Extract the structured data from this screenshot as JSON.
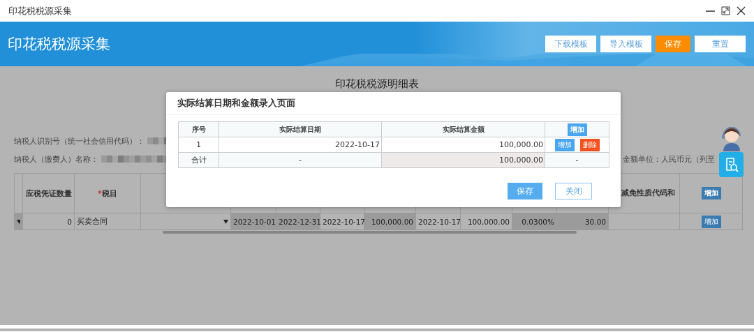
{
  "window": {
    "title": "印花税税源采集"
  },
  "header": {
    "title": "印花税税源采集",
    "buttons": [
      {
        "label": "下载模板",
        "kind": "default"
      },
      {
        "label": "导入模板",
        "kind": "default"
      },
      {
        "label": "保存",
        "kind": "primary"
      },
      {
        "label": "重置",
        "kind": "default"
      }
    ]
  },
  "page": {
    "table_title": "印花税税源明细表",
    "taxpayer_id_label": "纳税人识别号（统一社会信用代码）：",
    "taxpayer_name_label": "纳税人（缴费人）名称：",
    "currency_note": "金额单位：人民币元（列至",
    "table": {
      "columns": [
        {
          "kind": "blank"
        },
        {
          "kind": "text",
          "label": "应税凭证数量"
        },
        {
          "kind": "text",
          "label": "税目",
          "required_mark": "*"
        },
        {
          "kind": "blank"
        },
        {
          "kind": "blank"
        },
        {
          "kind": "blank"
        },
        {
          "kind": "blank"
        },
        {
          "kind": "blank"
        },
        {
          "kind": "blank"
        },
        {
          "kind": "blank"
        },
        {
          "kind": "blank"
        },
        {
          "kind": "blank"
        },
        {
          "kind": "text",
          "label": "减免性质代码和"
        },
        {
          "kind": "button",
          "label": "增加"
        }
      ],
      "rows": [
        {
          "cells": [
            {
              "kind": "dropdown",
              "readonly": true
            },
            {
              "kind": "number",
              "text": "0",
              "readonly": false
            },
            {
              "kind": "text",
              "text": "买卖合同",
              "readonly": false
            },
            {
              "kind": "dropdown",
              "readonly": false
            },
            {
              "kind": "number",
              "text": "2022-10-01",
              "readonly": true
            },
            {
              "kind": "number",
              "text": "2022-12-31",
              "readonly": true
            },
            {
              "kind": "number",
              "text": "2022-10-17",
              "readonly": false
            },
            {
              "kind": "number",
              "text": "100,000.00",
              "readonly": true
            },
            {
              "kind": "number",
              "text": "2022-10-17",
              "readonly": false
            },
            {
              "kind": "number",
              "text": "100,000.00",
              "readonly": false
            },
            {
              "kind": "number",
              "text": "0.0300%",
              "readonly": true
            },
            {
              "kind": "number",
              "text": "30.00",
              "readonly": true
            },
            {
              "kind": "blank",
              "readonly": false
            },
            {
              "kind": "button",
              "text": "增加"
            }
          ]
        }
      ]
    }
  },
  "dialog": {
    "title": "实际结算日期和金额录入页面",
    "columns": [
      "序号",
      "实际结算日期",
      "实际结算金额"
    ],
    "header_button": "增加",
    "rows": [
      {
        "index": "1",
        "date": "2022-10-17",
        "amount": "100,000.00",
        "actions": [
          {
            "label": "增加",
            "kind": "add"
          },
          {
            "label": "删除",
            "kind": "delete"
          }
        ]
      }
    ],
    "total": {
      "label": "合计",
      "date": "-",
      "amount": "100,000.00",
      "action": "-"
    },
    "buttons": [
      {
        "label": "保存",
        "kind": "primary"
      },
      {
        "label": "关闭",
        "kind": "default"
      }
    ]
  }
}
